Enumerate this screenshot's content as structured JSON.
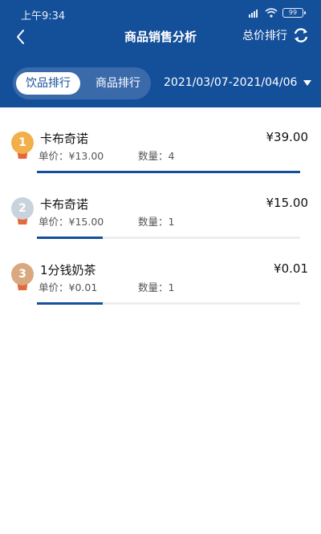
{
  "status": {
    "time": "上午9:34",
    "battery": "99"
  },
  "nav": {
    "title": "商品销售分析",
    "sort_label": "总价排行"
  },
  "tabs": [
    {
      "label": "饮品排行",
      "active": true
    },
    {
      "label": "商品排行",
      "active": false
    }
  ],
  "date_range": "2021/03/07-2021/04/06",
  "items": [
    {
      "rank": "1",
      "name": "卡布奇诺",
      "price": "¥39.00",
      "unit_price": "单价：¥13.00",
      "qty": "数量：4",
      "progress": 1.0,
      "medal_color": "#f2b04a"
    },
    {
      "rank": "2",
      "name": "卡布奇诺",
      "price": "¥15.00",
      "unit_price": "单价：¥15.00",
      "qty": "数量：1",
      "progress": 0.25,
      "medal_color": "#c8d3de"
    },
    {
      "rank": "3",
      "name": "1分钱奶茶",
      "price": "¥0.01",
      "unit_price": "单价：¥0.01",
      "qty": "数量：1",
      "progress": 0.25,
      "medal_color": "#d9a880"
    }
  ],
  "colors": {
    "brand": "#144f9a",
    "ribbon": "#e4683a"
  }
}
